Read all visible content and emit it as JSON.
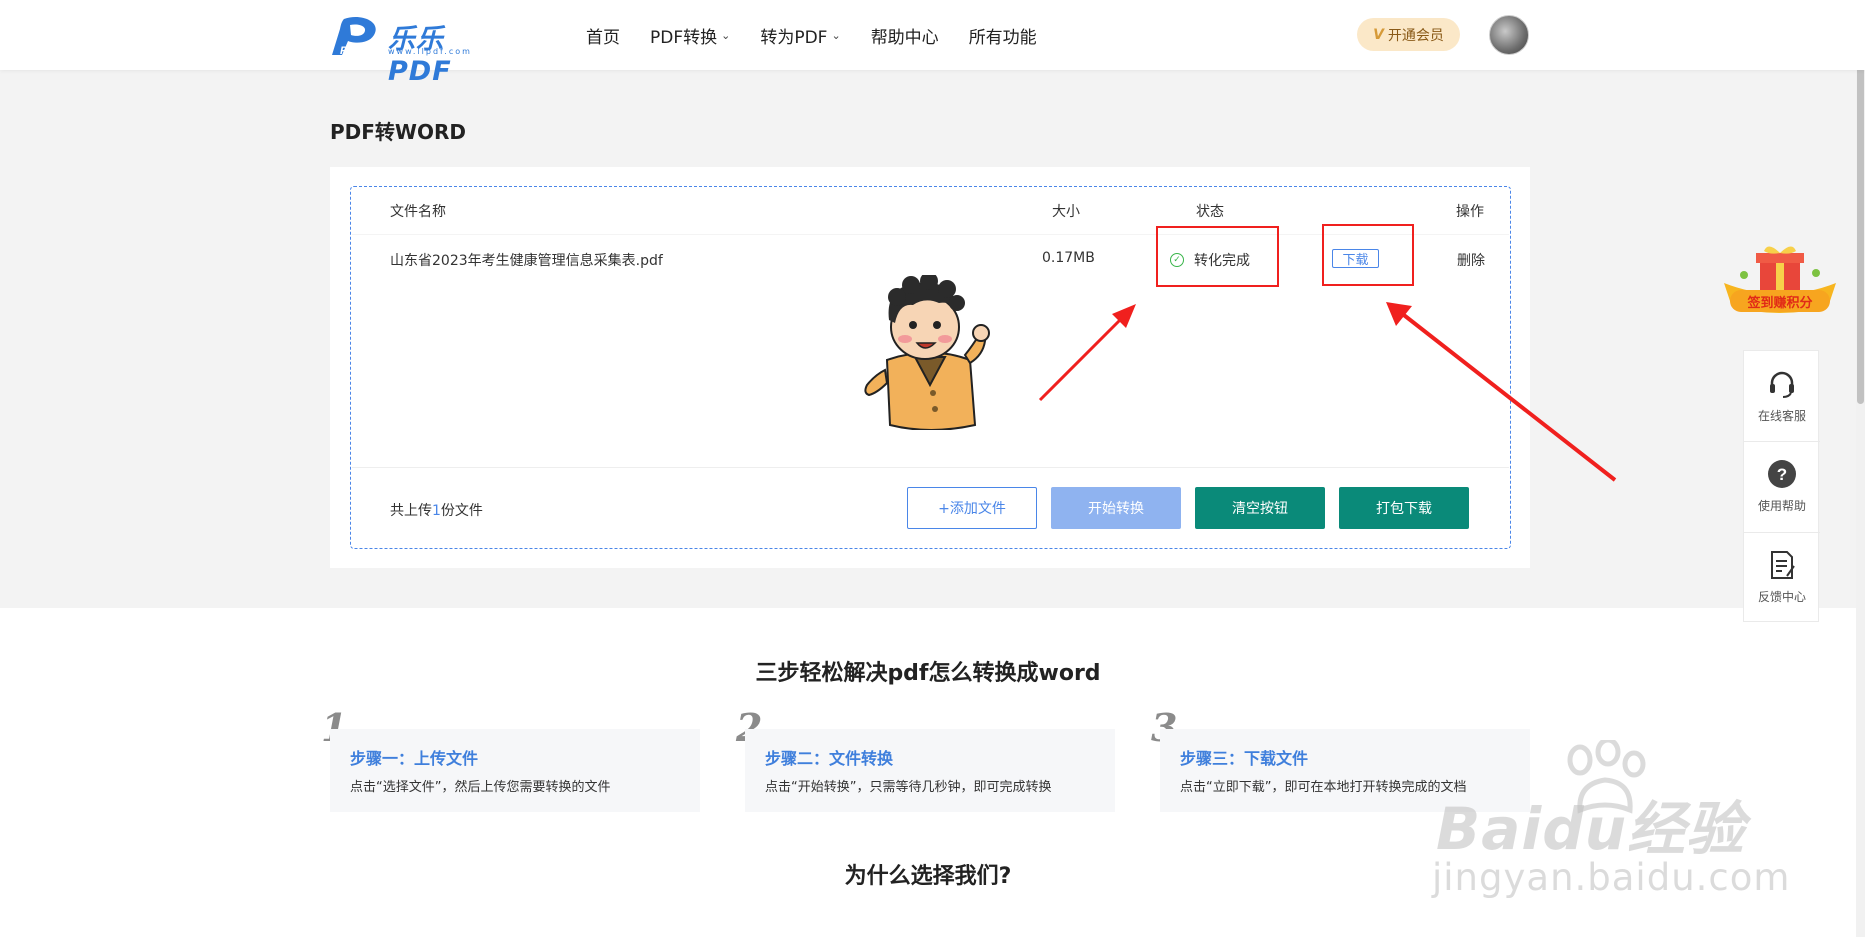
{
  "header": {
    "logo_text": "乐乐PDF",
    "logo_url": "www.llpdf.com",
    "nav": [
      {
        "label": "首页",
        "has_dropdown": false
      },
      {
        "label": "PDF转换",
        "has_dropdown": true
      },
      {
        "label": "转为PDF",
        "has_dropdown": true
      },
      {
        "label": "帮助中心",
        "has_dropdown": false
      },
      {
        "label": "所有功能",
        "has_dropdown": false
      }
    ],
    "vip_label": "开通会员"
  },
  "page_title": "PDF转WORD",
  "table": {
    "headers": {
      "name": "文件名称",
      "size": "大小",
      "status": "状态",
      "action": "操作"
    },
    "rows": [
      {
        "name": "山东省2023年考生健康管理信息采集表.pdf",
        "size": "0.17MB",
        "status": "转化完成",
        "download": "下载",
        "delete": "删除"
      }
    ]
  },
  "footer": {
    "count_prefix": "共上传",
    "count_value": "1",
    "count_suffix": "份文件",
    "buttons": {
      "add": "+添加文件",
      "start": "开始转换",
      "clear": "清空按钮",
      "pack": "打包下载"
    }
  },
  "side": {
    "gift_label": "签到赚积分",
    "items": [
      {
        "label": "在线客服",
        "icon": "headset-icon"
      },
      {
        "label": "使用帮助",
        "icon": "question-icon"
      },
      {
        "label": "反馈中心",
        "icon": "feedback-icon"
      }
    ]
  },
  "steps": {
    "title": "三步轻松解决pdf怎么转换成word",
    "items": [
      {
        "num": "1",
        "title": "步骤一：上传文件",
        "desc": "点击“选择文件”，然后上传您需要转换的文件"
      },
      {
        "num": "2",
        "title": "步骤二：文件转换",
        "desc": "点击“开始转换”，只需等待几秒钟，即可完成转换"
      },
      {
        "num": "3",
        "title": "步骤三：下载文件",
        "desc": "点击“立即下载”，即可在本地打开转换完成的文档"
      }
    ]
  },
  "why_title": "为什么选择我们?",
  "watermark": {
    "main": "Baidu经验",
    "sub": "jingyan.baidu.com"
  },
  "colors": {
    "accent": "#4a86e8",
    "teal": "#0a8a79",
    "annotation": "#f0201e"
  }
}
